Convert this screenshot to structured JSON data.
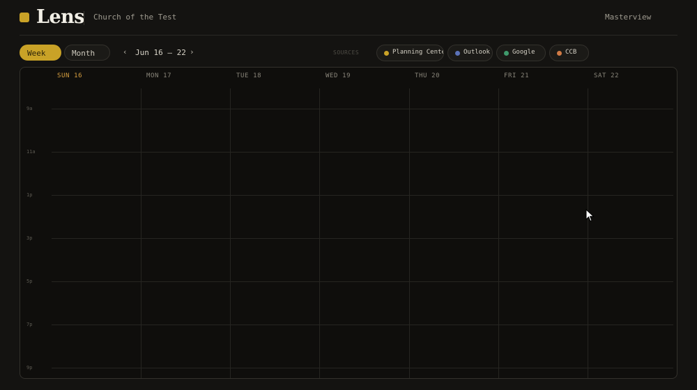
{
  "header": {
    "brand": "Lens",
    "org": "Church of the Test",
    "masterview": "Masterview"
  },
  "toolbar": {
    "views": [
      {
        "label": "Week",
        "active": true
      },
      {
        "label": "Month",
        "active": false
      }
    ],
    "prev": "‹",
    "next": "›",
    "range": "Jun 16 – 22",
    "sources_label": "SOURCES",
    "sources": [
      {
        "name": "Planning Center",
        "color": "#c9a227"
      },
      {
        "name": "Outlook",
        "color": "#5b72b8"
      },
      {
        "name": "Google",
        "color": "#3f9a6c"
      },
      {
        "name": "CCB",
        "color": "#d07a45"
      }
    ]
  },
  "calendar": {
    "days": [
      "SUN 16",
      "MON 17",
      "TUE 18",
      "WED 19",
      "THU 20",
      "FRI 21",
      "SAT 22"
    ],
    "today_index": 0,
    "hours": [
      "9a",
      "11a",
      "1p",
      "3p",
      "5p",
      "7p",
      "9p"
    ]
  },
  "colors": {
    "accent": "#c9a227",
    "today": "#d8a040",
    "background": "#141311"
  }
}
